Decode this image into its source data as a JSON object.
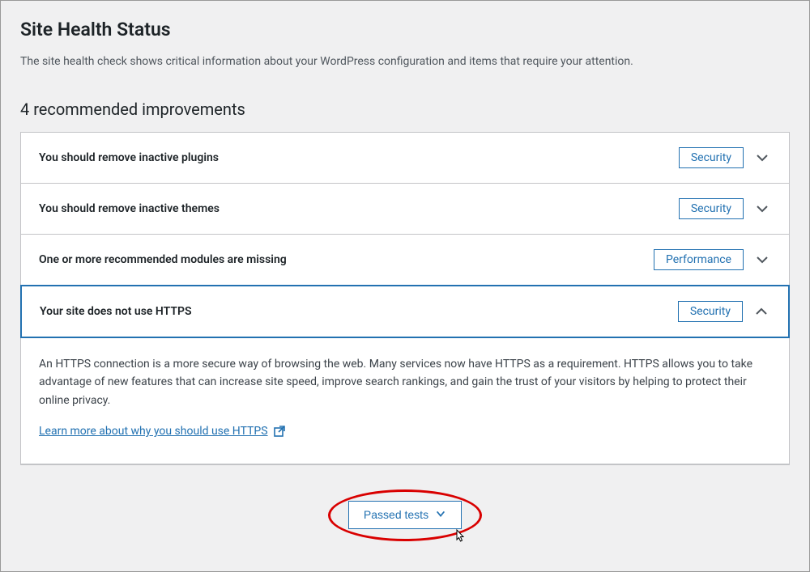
{
  "header": {
    "title": "Site Health Status",
    "description": "The site health check shows critical information about your WordPress configuration and items that require your attention."
  },
  "improvements": {
    "heading": "4 recommended improvements",
    "items": [
      {
        "title": "You should remove inactive plugins",
        "badge": "Security",
        "expanded": false
      },
      {
        "title": "You should remove inactive themes",
        "badge": "Security",
        "expanded": false
      },
      {
        "title": "One or more recommended modules are missing",
        "badge": "Performance",
        "expanded": false
      },
      {
        "title": "Your site does not use HTTPS",
        "badge": "Security",
        "expanded": true
      }
    ]
  },
  "expanded_detail": {
    "text": "An HTTPS connection is a more secure way of browsing the web. Many services now have HTTPS as a requirement. HTTPS allows you to take advantage of new features that can increase site speed, improve search rankings, and gain the trust of your visitors by helping to protect their online privacy.",
    "link_text": "Learn more about why you should use HTTPS "
  },
  "passed": {
    "button_label": "Passed tests"
  }
}
